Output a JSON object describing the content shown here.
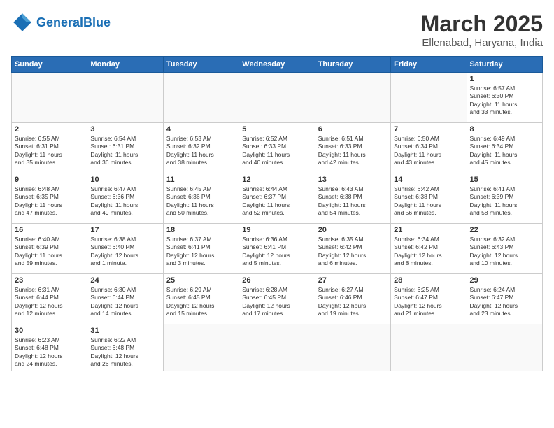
{
  "header": {
    "logo_general": "General",
    "logo_blue": "Blue",
    "month_title": "March 2025",
    "location": "Ellenabad, Haryana, India"
  },
  "days_of_week": [
    "Sunday",
    "Monday",
    "Tuesday",
    "Wednesday",
    "Thursday",
    "Friday",
    "Saturday"
  ],
  "weeks": [
    [
      {
        "day": "",
        "info": ""
      },
      {
        "day": "",
        "info": ""
      },
      {
        "day": "",
        "info": ""
      },
      {
        "day": "",
        "info": ""
      },
      {
        "day": "",
        "info": ""
      },
      {
        "day": "",
        "info": ""
      },
      {
        "day": "1",
        "info": "Sunrise: 6:57 AM\nSunset: 6:30 PM\nDaylight: 11 hours\nand 33 minutes."
      }
    ],
    [
      {
        "day": "2",
        "info": "Sunrise: 6:55 AM\nSunset: 6:31 PM\nDaylight: 11 hours\nand 35 minutes."
      },
      {
        "day": "3",
        "info": "Sunrise: 6:54 AM\nSunset: 6:31 PM\nDaylight: 11 hours\nand 36 minutes."
      },
      {
        "day": "4",
        "info": "Sunrise: 6:53 AM\nSunset: 6:32 PM\nDaylight: 11 hours\nand 38 minutes."
      },
      {
        "day": "5",
        "info": "Sunrise: 6:52 AM\nSunset: 6:33 PM\nDaylight: 11 hours\nand 40 minutes."
      },
      {
        "day": "6",
        "info": "Sunrise: 6:51 AM\nSunset: 6:33 PM\nDaylight: 11 hours\nand 42 minutes."
      },
      {
        "day": "7",
        "info": "Sunrise: 6:50 AM\nSunset: 6:34 PM\nDaylight: 11 hours\nand 43 minutes."
      },
      {
        "day": "8",
        "info": "Sunrise: 6:49 AM\nSunset: 6:34 PM\nDaylight: 11 hours\nand 45 minutes."
      }
    ],
    [
      {
        "day": "9",
        "info": "Sunrise: 6:48 AM\nSunset: 6:35 PM\nDaylight: 11 hours\nand 47 minutes."
      },
      {
        "day": "10",
        "info": "Sunrise: 6:47 AM\nSunset: 6:36 PM\nDaylight: 11 hours\nand 49 minutes."
      },
      {
        "day": "11",
        "info": "Sunrise: 6:45 AM\nSunset: 6:36 PM\nDaylight: 11 hours\nand 50 minutes."
      },
      {
        "day": "12",
        "info": "Sunrise: 6:44 AM\nSunset: 6:37 PM\nDaylight: 11 hours\nand 52 minutes."
      },
      {
        "day": "13",
        "info": "Sunrise: 6:43 AM\nSunset: 6:38 PM\nDaylight: 11 hours\nand 54 minutes."
      },
      {
        "day": "14",
        "info": "Sunrise: 6:42 AM\nSunset: 6:38 PM\nDaylight: 11 hours\nand 56 minutes."
      },
      {
        "day": "15",
        "info": "Sunrise: 6:41 AM\nSunset: 6:39 PM\nDaylight: 11 hours\nand 58 minutes."
      }
    ],
    [
      {
        "day": "16",
        "info": "Sunrise: 6:40 AM\nSunset: 6:39 PM\nDaylight: 11 hours\nand 59 minutes."
      },
      {
        "day": "17",
        "info": "Sunrise: 6:38 AM\nSunset: 6:40 PM\nDaylight: 12 hours\nand 1 minute."
      },
      {
        "day": "18",
        "info": "Sunrise: 6:37 AM\nSunset: 6:41 PM\nDaylight: 12 hours\nand 3 minutes."
      },
      {
        "day": "19",
        "info": "Sunrise: 6:36 AM\nSunset: 6:41 PM\nDaylight: 12 hours\nand 5 minutes."
      },
      {
        "day": "20",
        "info": "Sunrise: 6:35 AM\nSunset: 6:42 PM\nDaylight: 12 hours\nand 6 minutes."
      },
      {
        "day": "21",
        "info": "Sunrise: 6:34 AM\nSunset: 6:42 PM\nDaylight: 12 hours\nand 8 minutes."
      },
      {
        "day": "22",
        "info": "Sunrise: 6:32 AM\nSunset: 6:43 PM\nDaylight: 12 hours\nand 10 minutes."
      }
    ],
    [
      {
        "day": "23",
        "info": "Sunrise: 6:31 AM\nSunset: 6:44 PM\nDaylight: 12 hours\nand 12 minutes."
      },
      {
        "day": "24",
        "info": "Sunrise: 6:30 AM\nSunset: 6:44 PM\nDaylight: 12 hours\nand 14 minutes."
      },
      {
        "day": "25",
        "info": "Sunrise: 6:29 AM\nSunset: 6:45 PM\nDaylight: 12 hours\nand 15 minutes."
      },
      {
        "day": "26",
        "info": "Sunrise: 6:28 AM\nSunset: 6:45 PM\nDaylight: 12 hours\nand 17 minutes."
      },
      {
        "day": "27",
        "info": "Sunrise: 6:27 AM\nSunset: 6:46 PM\nDaylight: 12 hours\nand 19 minutes."
      },
      {
        "day": "28",
        "info": "Sunrise: 6:25 AM\nSunset: 6:47 PM\nDaylight: 12 hours\nand 21 minutes."
      },
      {
        "day": "29",
        "info": "Sunrise: 6:24 AM\nSunset: 6:47 PM\nDaylight: 12 hours\nand 23 minutes."
      }
    ],
    [
      {
        "day": "30",
        "info": "Sunrise: 6:23 AM\nSunset: 6:48 PM\nDaylight: 12 hours\nand 24 minutes."
      },
      {
        "day": "31",
        "info": "Sunrise: 6:22 AM\nSunset: 6:48 PM\nDaylight: 12 hours\nand 26 minutes."
      },
      {
        "day": "",
        "info": ""
      },
      {
        "day": "",
        "info": ""
      },
      {
        "day": "",
        "info": ""
      },
      {
        "day": "",
        "info": ""
      },
      {
        "day": "",
        "info": ""
      }
    ]
  ]
}
